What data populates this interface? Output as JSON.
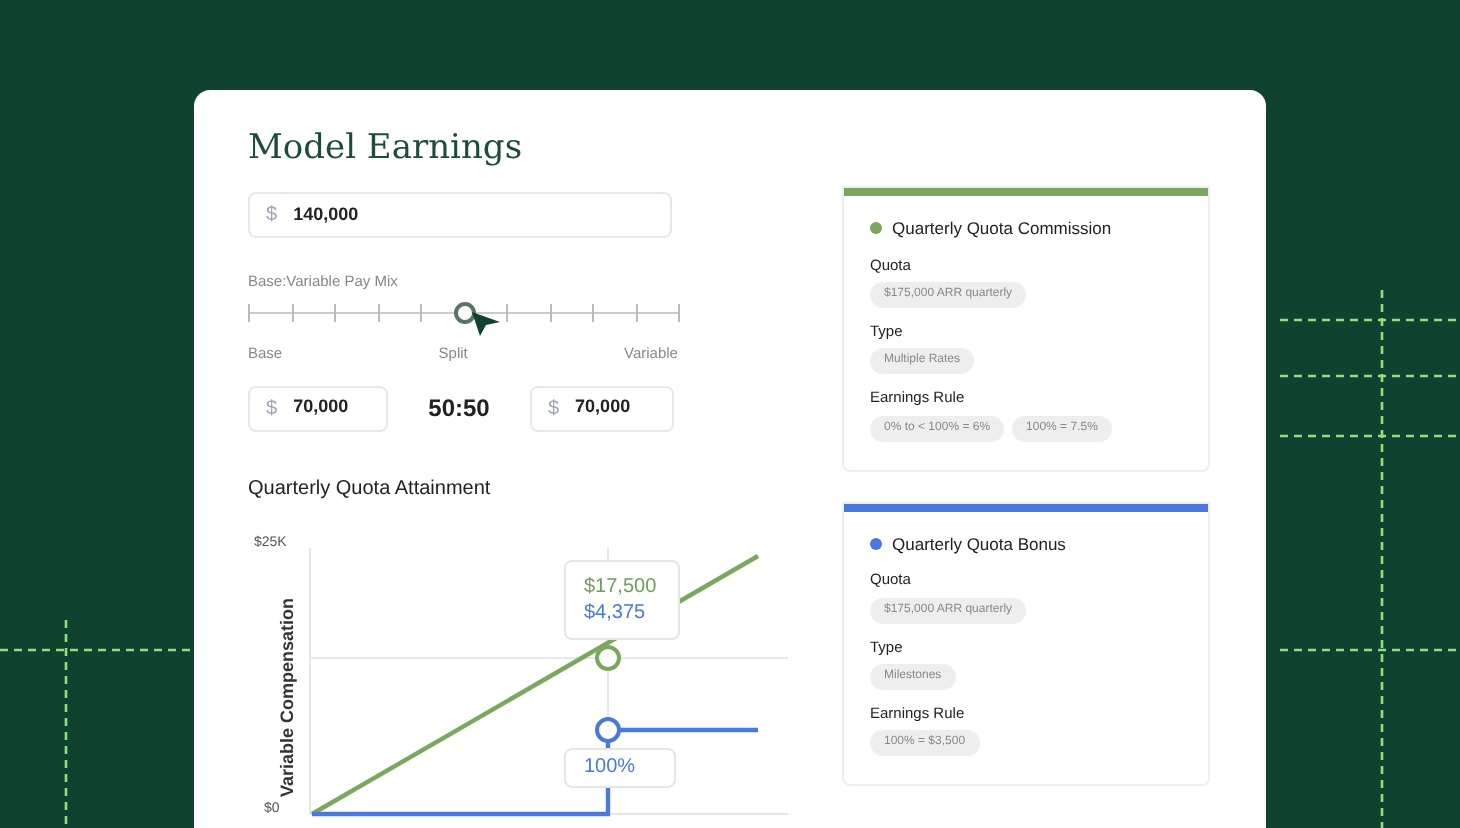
{
  "title": "Model Earnings",
  "salary": {
    "currency": "$",
    "value": "140,000"
  },
  "pay_mix": {
    "label": "Base:Variable Pay Mix",
    "level": 0.5,
    "labels": [
      "Base",
      "Split",
      "Variable"
    ]
  },
  "split": {
    "base": {
      "currency": "$",
      "value": "70,000"
    },
    "ratio": "50:50",
    "variable": {
      "currency": "$",
      "value": "70,000"
    }
  },
  "attainment": {
    "title": "Quarterly Quota Attainment",
    "ylabel": "Variable Compensation",
    "yticks": [
      "$25K",
      "$0"
    ],
    "tooltip": [
      {
        "text": "$17,500",
        "color": "#6e9f55"
      },
      {
        "text": "$4,375",
        "color": "#4a78e0"
      }
    ],
    "attainment_label": "100%"
  },
  "plans": [
    {
      "name": "Quarterly Quota Commission",
      "color": "#79a85e",
      "fields": [
        {
          "label": "Quota",
          "chips": [
            "$175,000 ARR quarterly"
          ]
        },
        {
          "label": "Type",
          "chips": [
            "Multiple Rates"
          ]
        },
        {
          "label": "Earnings Rule",
          "chips": [
            "0% to < 100% = 6%",
            "100% = 7.5%"
          ]
        }
      ]
    },
    {
      "name": "Quarterly Quota Bonus",
      "color": "#4a78e0",
      "fields": [
        {
          "label": "Quota",
          "chips": [
            "$175,000 ARR quarterly"
          ]
        },
        {
          "label": "Type",
          "chips": [
            "Milestones"
          ]
        },
        {
          "label": "Earnings Rule",
          "chips": [
            "100% = $3,500"
          ]
        }
      ]
    }
  ]
}
